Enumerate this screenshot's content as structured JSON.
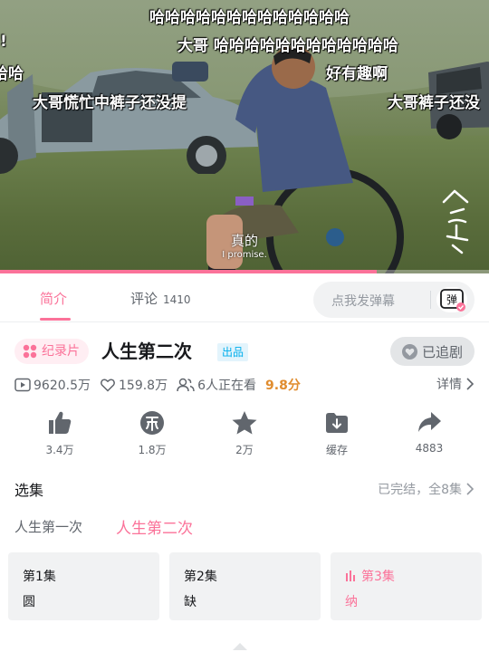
{
  "video": {
    "danmaku": [
      "哈哈哈哈哈哈哈哈哈哈哈哈哈",
      "大哥 哈哈哈哈哈哈哈哈哈哈哈哈",
      "好有趣啊",
      "大哥慌忙中裤子还没提",
      "大哥裤子还没",
      "!",
      "哈哈"
    ],
    "subtitle_cn": "真的",
    "subtitle_en": "I promise.",
    "progress_fraction": 0.77,
    "watermark": "人生第二次"
  },
  "tabs": {
    "intro": "简介",
    "comment": "评论",
    "comment_count": "1410",
    "danmu_placeholder": "点我发弹幕",
    "danmu_btn": "弹"
  },
  "info": {
    "category": "纪录片",
    "title": "人生第二次",
    "produced_tag": "出品",
    "follow_label": "已追剧",
    "plays": "9620.5万",
    "likes": "159.8万",
    "watching": "6人正在看",
    "score": "9.8分",
    "details": "详情"
  },
  "actions": [
    {
      "icon": "thumb-up-icon",
      "label": "3.4万"
    },
    {
      "icon": "coin-icon",
      "label": "1.8万"
    },
    {
      "icon": "star-icon",
      "label": "2万"
    },
    {
      "icon": "download-icon",
      "label": "缓存"
    },
    {
      "icon": "share-icon",
      "label": "4883"
    }
  ],
  "episodes": {
    "title": "选集",
    "status": "已完结，全8集",
    "seasons": [
      "人生第一次",
      "人生第二次"
    ],
    "items": [
      {
        "num": "第1集",
        "name": "圆"
      },
      {
        "num": "第2集",
        "name": "缺"
      },
      {
        "num": "第3集",
        "name": "纳"
      }
    ]
  },
  "colors": {
    "accent": "#fb7299",
    "score": "#e08c2e",
    "produced": "#00aeec"
  }
}
